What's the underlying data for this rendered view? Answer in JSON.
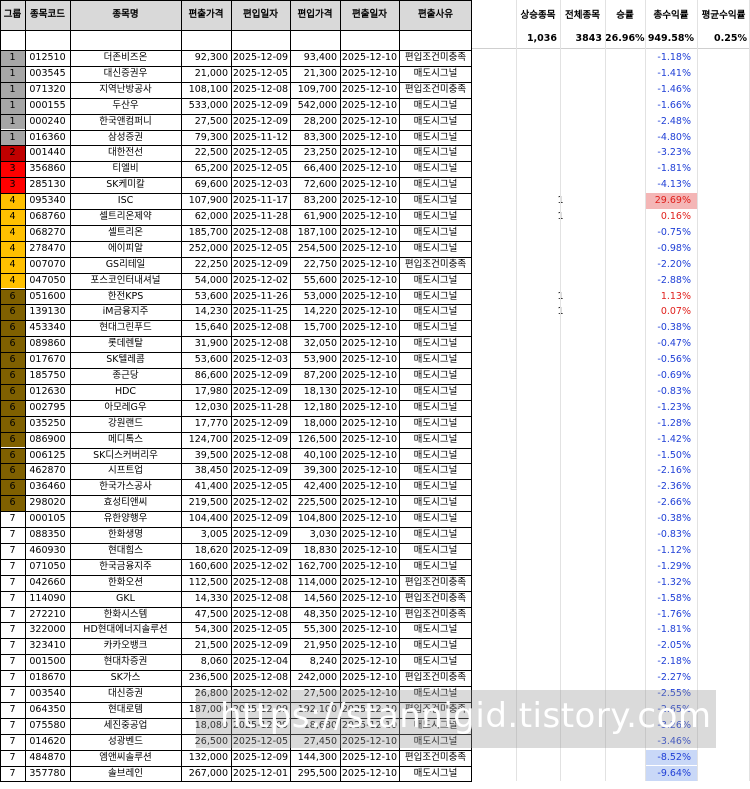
{
  "columns": [
    "그룹",
    "종목코드",
    "종목명",
    "편출가격",
    "편입일자",
    "편입가격",
    "편출일자",
    "편출사유"
  ],
  "stats": {
    "labels": [
      "상승종목",
      "전체종목",
      "승률",
      "총수익률",
      "평균수익률"
    ],
    "values": [
      "1,036",
      "3843",
      "26.96%",
      "949.58%",
      "0.25%"
    ]
  },
  "group_colors": {
    "1": "#a6a6a6",
    "2": "#c00000",
    "3": "#ff0000",
    "4": "#ffc000",
    "6": "#7f6000",
    "7": "#ffffff"
  },
  "rows": [
    {
      "g": "1",
      "code": "012510",
      "name": "더존비즈온",
      "out_price": "92,300",
      "in_date": "2025-12-09",
      "in_price": "93,400",
      "out_date": "2025-12-10",
      "reason": "편입조건미충족",
      "up": "",
      "ret": "-1.18%"
    },
    {
      "g": "1",
      "code": "003545",
      "name": "대신증권우",
      "out_price": "21,000",
      "in_date": "2025-12-05",
      "in_price": "21,300",
      "out_date": "2025-12-10",
      "reason": "매도시그널",
      "up": "",
      "ret": "-1.41%"
    },
    {
      "g": "1",
      "code": "071320",
      "name": "지역난방공사",
      "out_price": "108,100",
      "in_date": "2025-12-08",
      "in_price": "109,700",
      "out_date": "2025-12-10",
      "reason": "편입조건미충족",
      "up": "",
      "ret": "-1.46%"
    },
    {
      "g": "1",
      "code": "000155",
      "name": "두산우",
      "out_price": "533,000",
      "in_date": "2025-12-09",
      "in_price": "542,000",
      "out_date": "2025-12-10",
      "reason": "매도시그널",
      "up": "",
      "ret": "-1.66%"
    },
    {
      "g": "1",
      "code": "000240",
      "name": "한국앤컴퍼니",
      "out_price": "27,500",
      "in_date": "2025-12-09",
      "in_price": "28,200",
      "out_date": "2025-12-10",
      "reason": "매도시그널",
      "up": "",
      "ret": "-2.48%"
    },
    {
      "g": "1",
      "code": "016360",
      "name": "삼성증권",
      "out_price": "79,300",
      "in_date": "2025-11-12",
      "in_price": "83,300",
      "out_date": "2025-12-10",
      "reason": "매도시그널",
      "up": "",
      "ret": "-4.80%"
    },
    {
      "g": "2",
      "code": "001440",
      "name": "대한전선",
      "out_price": "22,500",
      "in_date": "2025-12-05",
      "in_price": "23,250",
      "out_date": "2025-12-10",
      "reason": "매도시그널",
      "up": "",
      "ret": "-3.23%"
    },
    {
      "g": "3",
      "code": "356860",
      "name": "티엘비",
      "out_price": "65,200",
      "in_date": "2025-12-05",
      "in_price": "66,400",
      "out_date": "2025-12-10",
      "reason": "매도시그널",
      "up": "",
      "ret": "-1.81%"
    },
    {
      "g": "3",
      "code": "285130",
      "name": "SK케미칼",
      "out_price": "69,600",
      "in_date": "2025-12-03",
      "in_price": "72,600",
      "out_date": "2025-12-10",
      "reason": "매도시그널",
      "up": "",
      "ret": "-4.13%"
    },
    {
      "g": "4",
      "code": "095340",
      "name": "ISC",
      "out_price": "107,900",
      "in_date": "2025-11-17",
      "in_price": "83,200",
      "out_date": "2025-12-10",
      "reason": "매도시그널",
      "up": "1",
      "ret": "29.69%"
    },
    {
      "g": "4",
      "code": "068760",
      "name": "셀트리온제약",
      "out_price": "62,000",
      "in_date": "2025-11-28",
      "in_price": "61,900",
      "out_date": "2025-12-10",
      "reason": "매도시그널",
      "up": "1",
      "ret": "0.16%"
    },
    {
      "g": "4",
      "code": "068270",
      "name": "셀트리온",
      "out_price": "185,700",
      "in_date": "2025-12-08",
      "in_price": "187,100",
      "out_date": "2025-12-10",
      "reason": "매도시그널",
      "up": "",
      "ret": "-0.75%"
    },
    {
      "g": "4",
      "code": "278470",
      "name": "에이피알",
      "out_price": "252,000",
      "in_date": "2025-12-05",
      "in_price": "254,500",
      "out_date": "2025-12-10",
      "reason": "매도시그널",
      "up": "",
      "ret": "-0.98%"
    },
    {
      "g": "4",
      "code": "007070",
      "name": "GS리테일",
      "out_price": "22,250",
      "in_date": "2025-12-09",
      "in_price": "22,750",
      "out_date": "2025-12-10",
      "reason": "편입조건미충족",
      "up": "",
      "ret": "-2.20%"
    },
    {
      "g": "4",
      "code": "047050",
      "name": "포스코인터내셔널",
      "out_price": "54,000",
      "in_date": "2025-12-02",
      "in_price": "55,600",
      "out_date": "2025-12-10",
      "reason": "매도시그널",
      "up": "",
      "ret": "-2.88%"
    },
    {
      "g": "6",
      "code": "051600",
      "name": "한전KPS",
      "out_price": "53,600",
      "in_date": "2025-11-26",
      "in_price": "53,000",
      "out_date": "2025-12-10",
      "reason": "매도시그널",
      "up": "1",
      "ret": "1.13%"
    },
    {
      "g": "6",
      "code": "139130",
      "name": "iM금융지주",
      "out_price": "14,230",
      "in_date": "2025-11-25",
      "in_price": "14,220",
      "out_date": "2025-12-10",
      "reason": "매도시그널",
      "up": "1",
      "ret": "0.07%"
    },
    {
      "g": "6",
      "code": "453340",
      "name": "현대그린푸드",
      "out_price": "15,640",
      "in_date": "2025-12-08",
      "in_price": "15,700",
      "out_date": "2025-12-10",
      "reason": "매도시그널",
      "up": "",
      "ret": "-0.38%"
    },
    {
      "g": "6",
      "code": "089860",
      "name": "롯데렌탈",
      "out_price": "31,900",
      "in_date": "2025-12-08",
      "in_price": "32,050",
      "out_date": "2025-12-10",
      "reason": "매도시그널",
      "up": "",
      "ret": "-0.47%"
    },
    {
      "g": "6",
      "code": "017670",
      "name": "SK텔레콤",
      "out_price": "53,600",
      "in_date": "2025-12-03",
      "in_price": "53,900",
      "out_date": "2025-12-10",
      "reason": "매도시그널",
      "up": "",
      "ret": "-0.56%"
    },
    {
      "g": "6",
      "code": "185750",
      "name": "종근당",
      "out_price": "86,600",
      "in_date": "2025-12-09",
      "in_price": "87,200",
      "out_date": "2025-12-10",
      "reason": "매도시그널",
      "up": "",
      "ret": "-0.69%"
    },
    {
      "g": "6",
      "code": "012630",
      "name": "HDC",
      "out_price": "17,980",
      "in_date": "2025-12-09",
      "in_price": "18,130",
      "out_date": "2025-12-10",
      "reason": "매도시그널",
      "up": "",
      "ret": "-0.83%"
    },
    {
      "g": "6",
      "code": "002795",
      "name": "아모레G우",
      "out_price": "12,030",
      "in_date": "2025-11-28",
      "in_price": "12,180",
      "out_date": "2025-12-10",
      "reason": "매도시그널",
      "up": "",
      "ret": "-1.23%"
    },
    {
      "g": "6",
      "code": "035250",
      "name": "강원랜드",
      "out_price": "17,770",
      "in_date": "2025-12-09",
      "in_price": "18,000",
      "out_date": "2025-12-10",
      "reason": "매도시그널",
      "up": "",
      "ret": "-1.28%"
    },
    {
      "g": "6",
      "code": "086900",
      "name": "메디톡스",
      "out_price": "124,700",
      "in_date": "2025-12-09",
      "in_price": "126,500",
      "out_date": "2025-12-10",
      "reason": "매도시그널",
      "up": "",
      "ret": "-1.42%"
    },
    {
      "g": "6",
      "code": "006125",
      "name": "SK디스커버리우",
      "out_price": "39,500",
      "in_date": "2025-12-08",
      "in_price": "40,100",
      "out_date": "2025-12-10",
      "reason": "매도시그널",
      "up": "",
      "ret": "-1.50%"
    },
    {
      "g": "6",
      "code": "462870",
      "name": "시프트업",
      "out_price": "38,450",
      "in_date": "2025-12-09",
      "in_price": "39,300",
      "out_date": "2025-12-10",
      "reason": "매도시그널",
      "up": "",
      "ret": "-2.16%"
    },
    {
      "g": "6",
      "code": "036460",
      "name": "한국가스공사",
      "out_price": "41,400",
      "in_date": "2025-12-05",
      "in_price": "42,400",
      "out_date": "2025-12-10",
      "reason": "매도시그널",
      "up": "",
      "ret": "-2.36%"
    },
    {
      "g": "6",
      "code": "298020",
      "name": "효성티앤씨",
      "out_price": "219,500",
      "in_date": "2025-12-02",
      "in_price": "225,500",
      "out_date": "2025-12-10",
      "reason": "매도시그널",
      "up": "",
      "ret": "-2.66%"
    },
    {
      "g": "7",
      "code": "000105",
      "name": "유한양행우",
      "out_price": "104,400",
      "in_date": "2025-12-09",
      "in_price": "104,800",
      "out_date": "2025-12-10",
      "reason": "매도시그널",
      "up": "",
      "ret": "-0.38%"
    },
    {
      "g": "7",
      "code": "088350",
      "name": "한화생명",
      "out_price": "3,005",
      "in_date": "2025-12-09",
      "in_price": "3,030",
      "out_date": "2025-12-10",
      "reason": "매도시그널",
      "up": "",
      "ret": "-0.83%"
    },
    {
      "g": "7",
      "code": "460930",
      "name": "현대힘스",
      "out_price": "18,620",
      "in_date": "2025-12-09",
      "in_price": "18,830",
      "out_date": "2025-12-10",
      "reason": "매도시그널",
      "up": "",
      "ret": "-1.12%"
    },
    {
      "g": "7",
      "code": "071050",
      "name": "한국금융지주",
      "out_price": "160,600",
      "in_date": "2025-12-02",
      "in_price": "162,700",
      "out_date": "2025-12-10",
      "reason": "매도시그널",
      "up": "",
      "ret": "-1.29%"
    },
    {
      "g": "7",
      "code": "042660",
      "name": "한화오션",
      "out_price": "112,500",
      "in_date": "2025-12-08",
      "in_price": "114,000",
      "out_date": "2025-12-10",
      "reason": "편입조건미충족",
      "up": "",
      "ret": "-1.32%"
    },
    {
      "g": "7",
      "code": "114090",
      "name": "GKL",
      "out_price": "14,330",
      "in_date": "2025-12-08",
      "in_price": "14,560",
      "out_date": "2025-12-10",
      "reason": "편입조건미충족",
      "up": "",
      "ret": "-1.58%"
    },
    {
      "g": "7",
      "code": "272210",
      "name": "한화시스템",
      "out_price": "47,500",
      "in_date": "2025-12-08",
      "in_price": "48,350",
      "out_date": "2025-12-10",
      "reason": "편입조건미충족",
      "up": "",
      "ret": "-1.76%"
    },
    {
      "g": "7",
      "code": "322000",
      "name": "HD현대에너지솔루션",
      "out_price": "54,300",
      "in_date": "2025-12-05",
      "in_price": "55,300",
      "out_date": "2025-12-10",
      "reason": "매도시그널",
      "up": "",
      "ret": "-1.81%"
    },
    {
      "g": "7",
      "code": "323410",
      "name": "카카오뱅크",
      "out_price": "21,500",
      "in_date": "2025-12-09",
      "in_price": "21,950",
      "out_date": "2025-12-10",
      "reason": "매도시그널",
      "up": "",
      "ret": "-2.05%"
    },
    {
      "g": "7",
      "code": "001500",
      "name": "현대차증권",
      "out_price": "8,060",
      "in_date": "2025-12-04",
      "in_price": "8,240",
      "out_date": "2025-12-10",
      "reason": "매도시그널",
      "up": "",
      "ret": "-2.18%"
    },
    {
      "g": "7",
      "code": "018670",
      "name": "SK가스",
      "out_price": "236,500",
      "in_date": "2025-12-08",
      "in_price": "242,000",
      "out_date": "2025-12-10",
      "reason": "편입조건미충족",
      "up": "",
      "ret": "-2.27%"
    },
    {
      "g": "7",
      "code": "003540",
      "name": "대신증권",
      "out_price": "26,800",
      "in_date": "2025-12-02",
      "in_price": "27,500",
      "out_date": "2025-12-10",
      "reason": "매도시그널",
      "up": "",
      "ret": "-2.55%"
    },
    {
      "g": "7",
      "code": "064350",
      "name": "현대로템",
      "out_price": "187,000",
      "in_date": "2025-12-09",
      "in_price": "192,100",
      "out_date": "2025-12-10",
      "reason": "편입조건미충족",
      "up": "",
      "ret": "-2.65%"
    },
    {
      "g": "7",
      "code": "075580",
      "name": "세진중공업",
      "out_price": "18,080",
      "in_date": "2025-12-09",
      "in_price": "18,680",
      "out_date": "2025-12-10",
      "reason": "매도시그널",
      "up": "",
      "ret": "-3.26%"
    },
    {
      "g": "7",
      "code": "014620",
      "name": "성광벤드",
      "out_price": "26,500",
      "in_date": "2025-12-05",
      "in_price": "27,450",
      "out_date": "2025-12-10",
      "reason": "매도시그널",
      "up": "",
      "ret": "-3.46%"
    },
    {
      "g": "7",
      "code": "484870",
      "name": "엠앤씨솔루션",
      "out_price": "132,000",
      "in_date": "2025-12-09",
      "in_price": "144,300",
      "out_date": "2025-12-10",
      "reason": "편입조건미충족",
      "up": "",
      "ret": "-8.52%"
    },
    {
      "g": "7",
      "code": "357780",
      "name": "솔브레인",
      "out_price": "267,000",
      "in_date": "2025-12-01",
      "in_price": "295,500",
      "out_date": "2025-12-10",
      "reason": "매도시그널",
      "up": "",
      "ret": "-9.64%"
    }
  ],
  "watermark": "https://stannigid.tistory.com"
}
